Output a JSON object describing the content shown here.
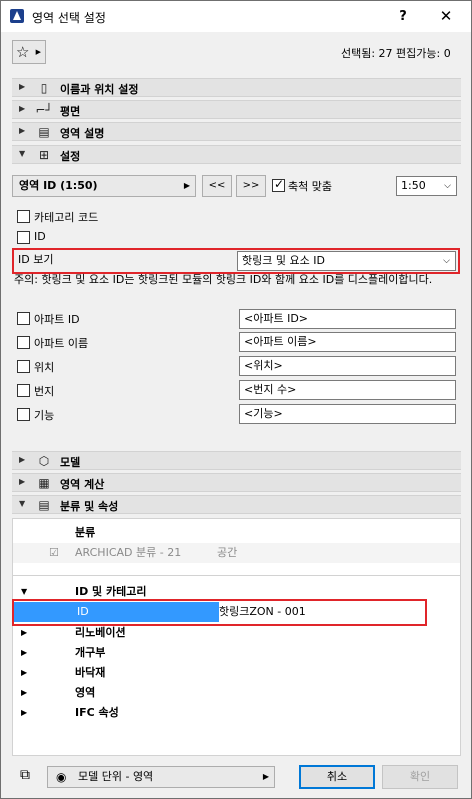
{
  "window": {
    "title": "영역 선택 설정",
    "help": "?",
    "close": "✕"
  },
  "toolbar": {
    "favorites_icon": "star-icon",
    "selection_status": "선택됨: 27 편집가능: 0"
  },
  "sections": [
    {
      "label": "이름과 위치 설정",
      "icon": "document-icon",
      "expanded": false
    },
    {
      "label": "평면",
      "icon": "floor-plan-icon",
      "expanded": false
    },
    {
      "label": "영역 설명",
      "icon": "keyboard-icon",
      "expanded": false
    },
    {
      "label": "설정",
      "icon": "settings-icon",
      "expanded": true
    },
    {
      "label": "모델",
      "icon": "cube-icon",
      "expanded": false
    },
    {
      "label": "영역 계산",
      "icon": "calculator-icon",
      "expanded": false
    },
    {
      "label": "분류 및 속성",
      "icon": "list-icon",
      "expanded": true
    }
  ],
  "settings": {
    "zone_id_combo": "영역 ID (1:50)",
    "prev": "<<",
    "next": ">>",
    "scale_check_label": "축척 맞춤",
    "scale_value": "1:50",
    "category_code": "카테고리 코드",
    "id_label": "ID",
    "id_view_label": "ID 보기",
    "id_view_value": "핫링크 및 요소 ID",
    "note": "주의: 핫링크 및 요소 ID는 핫링크된 모듈의 핫링크 ID와 함께 요소 ID를 디스플레이합니다.",
    "fields": [
      {
        "label": "아파트 ID",
        "value": "<아파트 ID>"
      },
      {
        "label": "아파트 이름",
        "value": "<아파트 이름>"
      },
      {
        "label": "위치",
        "value": "<위치>"
      },
      {
        "label": "번지",
        "value": "<번지 수>"
      },
      {
        "label": "기능",
        "value": "<기능>"
      }
    ]
  },
  "classification": {
    "header": "분류",
    "row_system": "ARCHICAD 분류 - 21",
    "row_value": "공간",
    "groups": [
      {
        "label": "ID 및 카테고리",
        "expanded": true
      },
      {
        "label": "리노베이션",
        "expanded": false
      },
      {
        "label": "개구부",
        "expanded": false
      },
      {
        "label": "바닥재",
        "expanded": false
      },
      {
        "label": "영역",
        "expanded": false
      },
      {
        "label": "IFC 속성",
        "expanded": false
      }
    ],
    "id_row_label": "ID",
    "id_row_value": "핫링크ZON - 001"
  },
  "footer": {
    "layer_combo": "모델 단위 - 영역",
    "cancel": "취소",
    "ok": "확인"
  },
  "colors": {
    "highlight": "#e0252a",
    "selection": "#3399ff"
  }
}
